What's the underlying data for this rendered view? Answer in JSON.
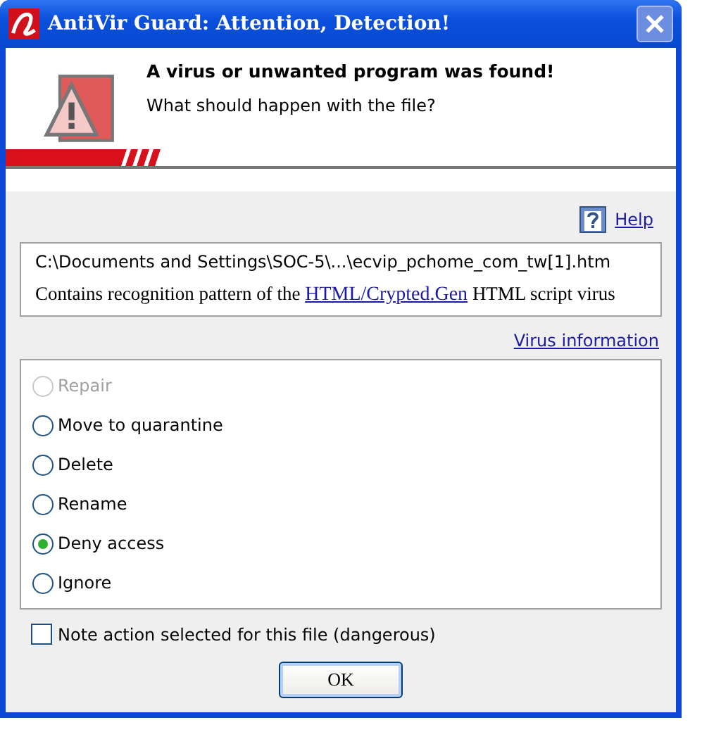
{
  "window": {
    "title": "AntiVir Guard: Attention, Detection!",
    "close_disabled": true
  },
  "header": {
    "heading": "A virus or unwanted program was found!",
    "question": "What should happen with the file?"
  },
  "help_link": "Help",
  "detection": {
    "path": "C:\\Documents and Settings\\SOC-5\\...\\ecvip_pchome_com_tw[1].htm",
    "text_before": "Contains recognition pattern of the",
    "virus_link": "HTML/Crypted.Gen",
    "text_after": "HTML script virus"
  },
  "virus_info_link": "Virus information",
  "actions": [
    {
      "label": "Repair",
      "selected": false,
      "disabled": true
    },
    {
      "label": "Move to quarantine",
      "selected": false,
      "disabled": false
    },
    {
      "label": "Delete",
      "selected": false,
      "disabled": false
    },
    {
      "label": "Rename",
      "selected": false,
      "disabled": false
    },
    {
      "label": "Deny access",
      "selected": true,
      "disabled": false
    },
    {
      "label": "Ignore",
      "selected": false,
      "disabled": false
    }
  ],
  "note_checkbox": {
    "label": "Note action selected for this file (dangerous)",
    "checked": false
  },
  "ok_button": "OK"
}
